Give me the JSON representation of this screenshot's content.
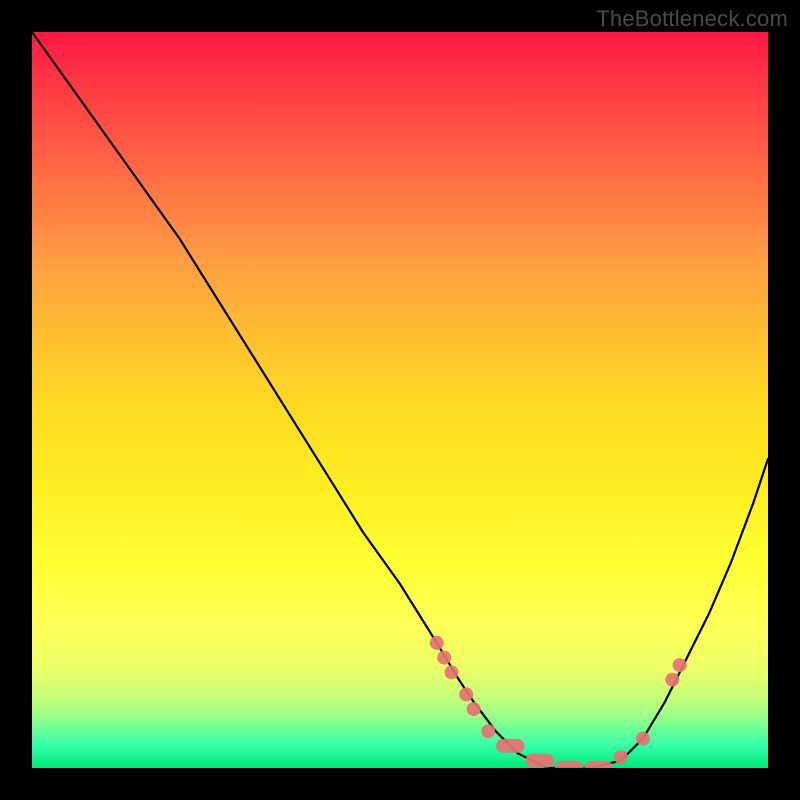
{
  "watermark": "TheBottleneck.com",
  "chart_data": {
    "type": "line",
    "title": "",
    "xlabel": "",
    "ylabel": "",
    "xlim": [
      0,
      100
    ],
    "ylim": [
      0,
      100
    ],
    "background_gradient": {
      "top": "#ff1744",
      "middle": "#ffee22",
      "bottom": "#00e676"
    },
    "curve": {
      "description": "V-shaped bottleneck curve descending from top-left to a minimum then rising to right edge",
      "x": [
        0,
        5,
        10,
        15,
        20,
        25,
        30,
        35,
        40,
        45,
        50,
        55,
        58,
        60,
        63,
        66,
        70,
        73,
        76,
        80,
        83,
        86,
        89,
        92,
        95,
        98,
        100
      ],
      "y": [
        100,
        93,
        86,
        79,
        72,
        64,
        56,
        48,
        40,
        32,
        25,
        17,
        12,
        9,
        5,
        2,
        0,
        0,
        0,
        1,
        4,
        9,
        15,
        21,
        28,
        36,
        42
      ]
    },
    "markers": {
      "description": "Visible data markers on the curve (coral dots and pill segments)",
      "color": "#e57373",
      "points": [
        {
          "x": 55,
          "y": 17
        },
        {
          "x": 56,
          "y": 15
        },
        {
          "x": 57,
          "y": 13
        },
        {
          "x": 59,
          "y": 10
        },
        {
          "x": 60,
          "y": 8
        },
        {
          "x": 62,
          "y": 5
        },
        {
          "x": 64,
          "y": 3
        },
        {
          "x": 66,
          "y": 2
        },
        {
          "x": 68,
          "y": 1
        },
        {
          "x": 70,
          "y": 0
        },
        {
          "x": 72,
          "y": 0
        },
        {
          "x": 74,
          "y": 0
        },
        {
          "x": 76,
          "y": 0
        },
        {
          "x": 78,
          "y": 0.5
        },
        {
          "x": 80,
          "y": 1.5
        },
        {
          "x": 83,
          "y": 4
        },
        {
          "x": 87,
          "y": 12
        },
        {
          "x": 88,
          "y": 14
        }
      ]
    }
  }
}
